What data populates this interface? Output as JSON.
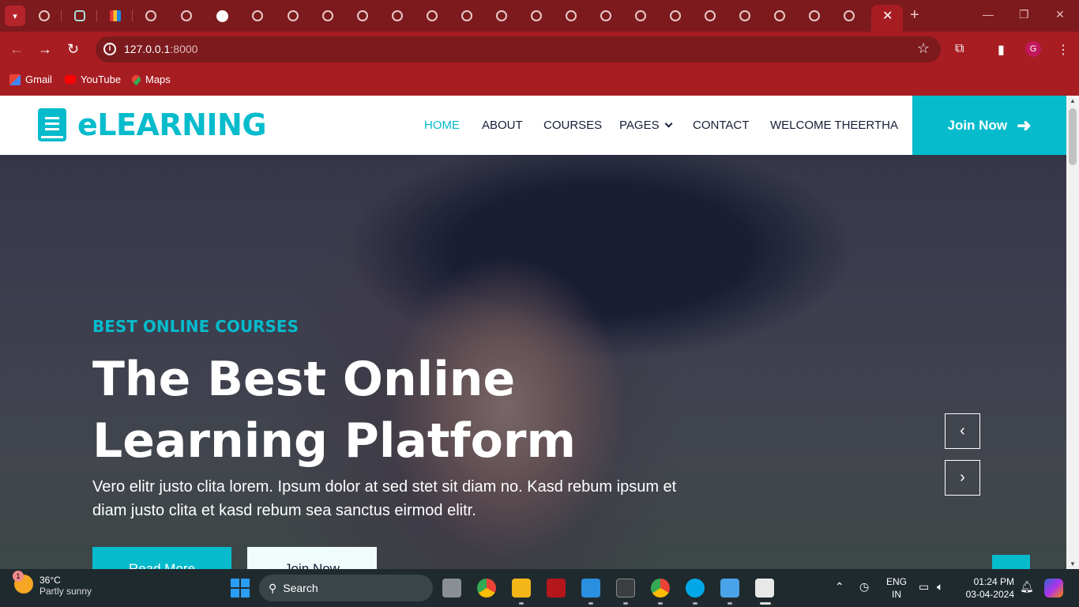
{
  "browser": {
    "url_host": "127.0.0.1",
    "url_port": ":8000",
    "active_tab_close": "✕",
    "new_tab": "+",
    "profile_initial": "G",
    "bookmarks": [
      {
        "label": "Gmail",
        "icon": "gmail-icon"
      },
      {
        "label": "YouTube",
        "icon": "youtube-icon"
      },
      {
        "label": "Maps",
        "icon": "maps-icon"
      }
    ]
  },
  "site": {
    "brand": "eLEARNING",
    "nav": {
      "home": "HOME",
      "about": "ABOUT",
      "courses": "COURSES",
      "pages": "PAGES",
      "contact": "CONTACT",
      "welcome": "WELCOME THEERTHA",
      "join_now": "Join Now"
    },
    "hero": {
      "kicker": "BEST ONLINE COURSES",
      "headline": "The Best Online Learning Platform",
      "description": "Vero elitr justo clita lorem. Ipsum dolor at sed stet sit diam no. Kasd rebum ipsum et diam justo clita et kasd rebum sea sanctus eirmod elitr.",
      "btn_read_more": "Read More",
      "btn_join_now": "Join Now"
    },
    "colors": {
      "accent": "#06bbcc",
      "dark": "#181d38",
      "browser": "#a71d22"
    }
  },
  "taskbar": {
    "weather_temp": "36°C",
    "weather_desc": "Partly sunny",
    "weather_badge": "1",
    "search_label": "Search",
    "lang_top": "ENG",
    "lang_bottom": "IN",
    "time": "01:24 PM",
    "date": "03-04-2024"
  }
}
